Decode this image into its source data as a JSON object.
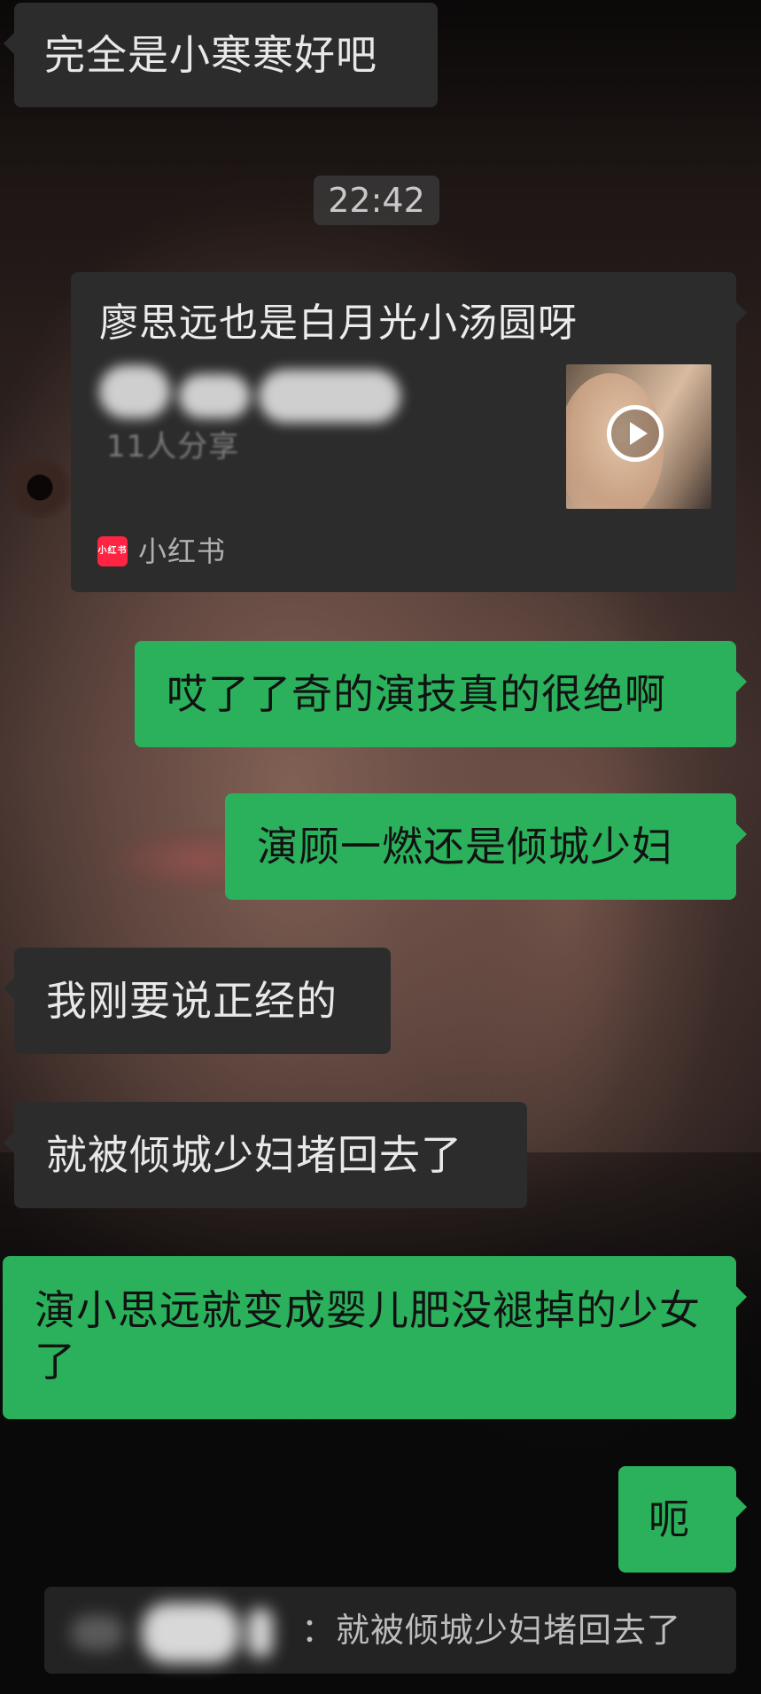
{
  "messages": [
    {
      "text": "完全是小寒寒好吧"
    },
    {
      "text": "哎了了奇的演技真的很绝啊"
    },
    {
      "text": "演顾一燃还是倾城少妇"
    },
    {
      "text": "我刚要说正经的"
    },
    {
      "text": "就被倾城少妇堵回去了"
    },
    {
      "text": "演小思远就变成婴儿肥没褪掉的少女了"
    },
    {
      "text": "呃"
    }
  ],
  "timestamp": "22:42",
  "shared_card": {
    "title": "廖思远也是白月光小汤圆呀",
    "blurred_subtitle": "11人分享",
    "source_icon_text": "小红书",
    "source_name": "小红书",
    "thumbnail_icon": "play-icon"
  },
  "quote": {
    "separator": "：",
    "text": "就被倾城少妇堵回去了"
  },
  "colors": {
    "sent_bubble": "#2bb15c",
    "received_bubble": "#2c2c2c",
    "xiaohongshu_red": "#ff2442"
  }
}
